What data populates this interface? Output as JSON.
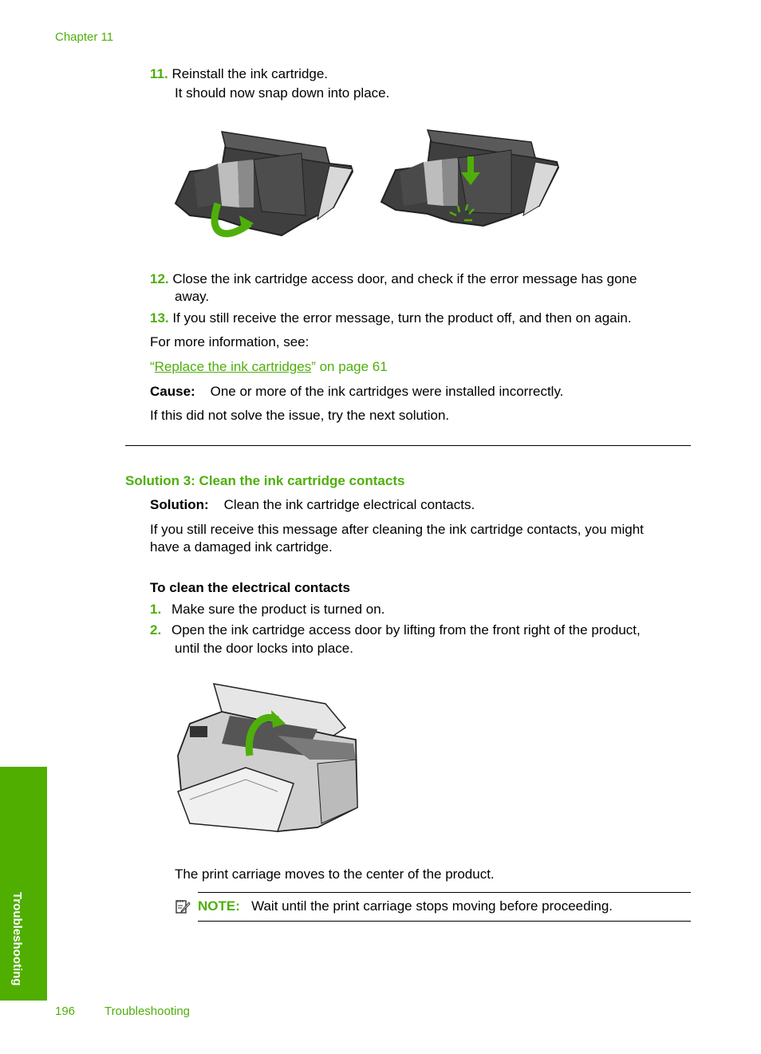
{
  "header": {
    "chapter": "Chapter 11"
  },
  "steps_top": [
    {
      "number": "11.",
      "text": "Reinstall the ink cartridge.",
      "subtext": "It should now snap down into place."
    },
    {
      "number": "12.",
      "text": "Close the ink cartridge access door, and check if the error message has gone",
      "text2": "away."
    },
    {
      "number": "13.",
      "text": "If you still receive the error message, turn the product off, and then on again."
    }
  ],
  "figures": {
    "cartridge_left": "Ink cartridge being pushed in (curved green arrow)",
    "cartridge_right": "Ink cartridge snapped into place (green down arrow)",
    "printer": "Printer with ink cartridge access door lifted (green curved arrow)"
  },
  "more_info": {
    "label": "For more information, see:",
    "link_open_quote": "“",
    "link_text": "Replace the ink cartridges",
    "link_close": "” on page 61"
  },
  "cause": {
    "label": "Cause:",
    "text": "One or more of the ink cartridges were installed incorrectly."
  },
  "next_solution": "If this did not solve the issue, try the next solution.",
  "solution3": {
    "heading": "Solution 3: Clean the ink cartridge contacts",
    "solution_label": "Solution:",
    "solution_text": "Clean the ink cartridge electrical contacts.",
    "para_line1": "If you still receive this message after cleaning the ink cartridge contacts, you might",
    "para_line2": "have a damaged ink cartridge.",
    "procedure_title": "To clean the electrical contacts",
    "steps": [
      {
        "number": "1.",
        "text": "Make sure the product is turned on."
      },
      {
        "number": "2.",
        "text": "Open the ink cartridge access door by lifting from the front right of the product,",
        "text2": "until the door locks into place."
      }
    ],
    "carriage_text": "The print carriage moves to the center of the product.",
    "note_label": "NOTE:",
    "note_text": "Wait until the print carriage stops moving before proceeding."
  },
  "sidebar": {
    "tab_label": "Troubleshooting"
  },
  "footer": {
    "page_number": "196",
    "section": "Troubleshooting"
  }
}
